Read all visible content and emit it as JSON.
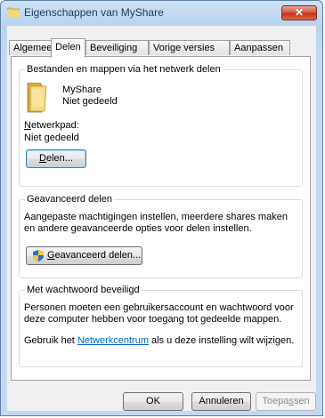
{
  "window": {
    "title": "Eigenschappen van MyShare",
    "close_glyph": "✕"
  },
  "tabs": [
    {
      "label": "Algemeen"
    },
    {
      "label": "Delen"
    },
    {
      "label": "Beveiliging"
    },
    {
      "label": "Vorige versies"
    },
    {
      "label": "Aanpassen"
    }
  ],
  "share_group": {
    "title": "Bestanden en mappen via het netwerk delen",
    "folder_name": "MyShare",
    "folder_status": "Niet gedeeld",
    "network_path_label_first": "N",
    "network_path_label_rest": "etwerkpad:",
    "network_path_value": "Niet gedeeld",
    "share_button_first": "D",
    "share_button_rest": "elen..."
  },
  "advanced_group": {
    "title": "Geavanceerd delen",
    "description": "Aangepaste machtigingen instellen, meerdere shares maken en andere geavanceerde opties voor delen instellen.",
    "button_first": "G",
    "button_rest": "eavanceerd delen..."
  },
  "password_group": {
    "title": "Met wachtwoord beveiligd",
    "description": "Personen moeten een gebruikersaccount en wachtwoord voor deze computer hebben voor toegang tot gedeelde mappen.",
    "network_prefix": "Gebruik het ",
    "network_link": "Netwerkcentrum",
    "network_suffix": " als u deze instelling wilt wijzigen."
  },
  "footer": {
    "ok": "OK",
    "cancel": "Annuleren",
    "apply_first": "Toepa",
    "apply_underlined": "s",
    "apply_rest": "sen"
  },
  "icons": {
    "title_icon": "folder-icon",
    "share_icon": "folder-icon",
    "uac_icon": "shield-icon"
  }
}
